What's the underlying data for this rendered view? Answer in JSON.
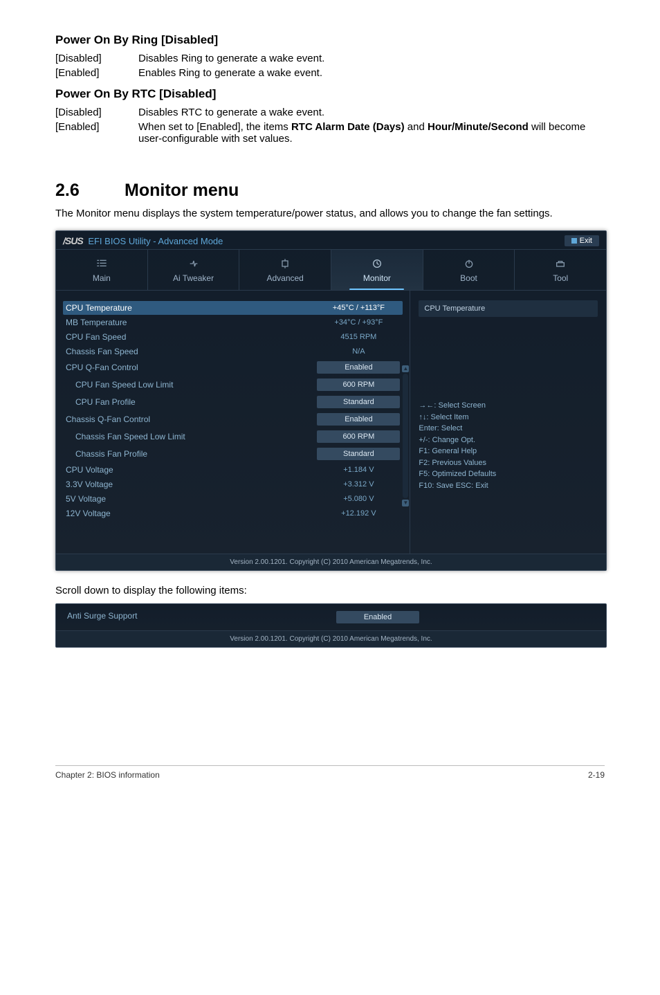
{
  "doc": {
    "powerRing": {
      "title": "Power On By Ring [Disabled]",
      "disabledKey": "[Disabled]",
      "disabledDesc": "Disables Ring to generate a wake event.",
      "enabledKey": "[Enabled]",
      "enabledDesc": "Enables Ring to generate a wake event."
    },
    "powerRtc": {
      "title": "Power On By RTC [Disabled]",
      "disabledKey": "[Disabled]",
      "disabledDesc": "Disables RTC to generate a wake event.",
      "enabledKey": "[Enabled]",
      "enabledDescPrefix": "When set to [Enabled], the items ",
      "enabledBold1": "RTC Alarm Date (Days)",
      "enabledMid": " and ",
      "enabledBold2": "Hour/Minute/Second",
      "enabledDescSuffix": " will become user-configurable with set values."
    },
    "sectionNum": "2.6",
    "sectionTitle": "Monitor menu",
    "sectionDesc": "The Monitor menu displays the system temperature/power status, and allows you to change the fan settings.",
    "scrollNote": "Scroll down to display the following items:"
  },
  "bios": {
    "brand": "/SUS",
    "title": "EFI BIOS Utility - Advanced Mode",
    "exit": "Exit",
    "tabs": {
      "main": "Main",
      "ai": "Ai  Tweaker",
      "advanced": "Advanced",
      "monitor": "Monitor",
      "boot": "Boot",
      "tool": "Tool"
    },
    "rows": {
      "cpuTemp": {
        "label": "CPU Temperature",
        "value": "+45°C / +113°F"
      },
      "mbTemp": {
        "label": "MB Temperature",
        "value": "+34°C / +93°F"
      },
      "cpuFan": {
        "label": "CPU Fan Speed",
        "value": "4515 RPM"
      },
      "chassisFan": {
        "label": "Chassis Fan Speed",
        "value": "N/A"
      },
      "cpuQFan": {
        "label": "CPU Q-Fan Control",
        "value": "Enabled"
      },
      "cpuFanLow": {
        "label": "CPU Fan Speed Low Limit",
        "value": "600 RPM"
      },
      "cpuFanProfile": {
        "label": "CPU Fan Profile",
        "value": "Standard"
      },
      "chassisQFan": {
        "label": "Chassis Q-Fan Control",
        "value": "Enabled"
      },
      "chassisFanLow": {
        "label": "Chassis Fan Speed Low Limit",
        "value": "600 RPM"
      },
      "chassisFanProfile": {
        "label": "Chassis Fan Profile",
        "value": "Standard"
      },
      "cpuV": {
        "label": "CPU Voltage",
        "value": "+1.184 V"
      },
      "v33": {
        "label": "3.3V Voltage",
        "value": "+3.312 V"
      },
      "v5": {
        "label": "5V Voltage",
        "value": "+5.080 V"
      },
      "v12": {
        "label": "12V Voltage",
        "value": "+12.192 V"
      }
    },
    "help": {
      "title": "CPU Temperature",
      "k1": "→←:  Select Screen",
      "k2": "↑↓:  Select Item",
      "k3": "Enter:  Select",
      "k4": "+/-:  Change Opt.",
      "k5": "F1:  General Help",
      "k6": "F2:  Previous Values",
      "k7": "F5:  Optimized Defaults",
      "k8": "F10:  Save    ESC:  Exit"
    },
    "footer": "Version  2.00.1201.   Copyright  (C)  2010  American  Megatrends,  Inc."
  },
  "biosMini": {
    "label": "Anti Surge Support",
    "value": "Enabled",
    "footer": "Version  2.00.1201.   Copyright  (C)  2010  American  Megatrends,  Inc."
  },
  "pageFooter": {
    "left": "Chapter 2: BIOS information",
    "right": "2-19"
  }
}
